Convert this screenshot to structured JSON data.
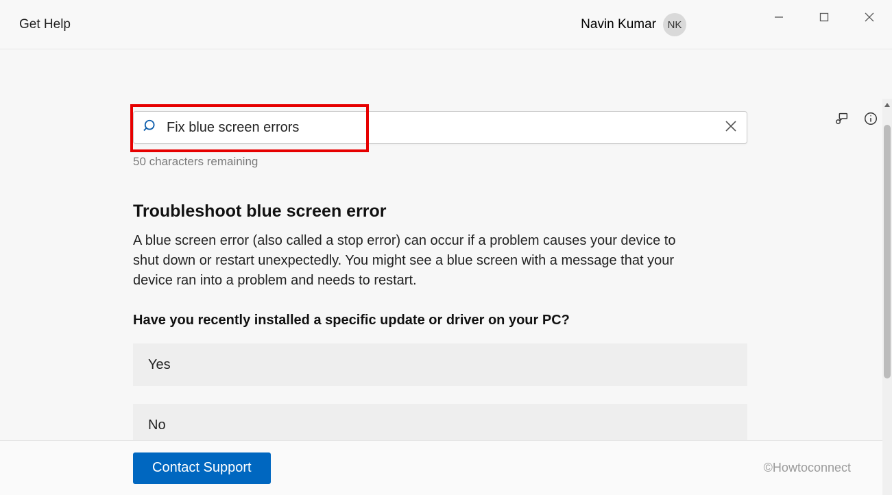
{
  "titlebar": {
    "app_title": "Get Help",
    "user_name": "Navin Kumar",
    "user_initials": "NK"
  },
  "search": {
    "value": "Fix blue screen errors",
    "characters_remaining": "50 characters remaining"
  },
  "article": {
    "heading": "Troubleshoot blue screen error",
    "body": "A blue screen error (also called a stop error) can occur if a problem causes your device to shut down or restart unexpectedly. You might see a blue screen with a message that your device ran into a problem and needs to restart.",
    "question": "Have you recently installed a specific update or driver on your PC?",
    "choices": [
      "Yes",
      "No"
    ]
  },
  "bottom": {
    "contact_support": "Contact Support",
    "watermark": "©Howtoconnect"
  }
}
